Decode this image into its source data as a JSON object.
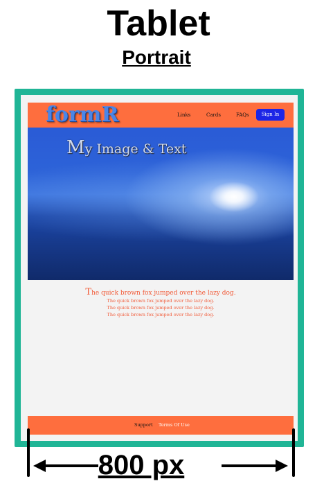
{
  "device": {
    "label": "Tablet",
    "orientation": "Portrait"
  },
  "site": {
    "logo": "formR",
    "nav": {
      "links": "Links",
      "cards": "Cards",
      "faqs": "FAQs",
      "signin": "Sign In"
    },
    "hero": {
      "title_cap": "M",
      "title_rest": "y Image & Text"
    },
    "content": {
      "lead_cap": "T",
      "lead_rest": "he quick brown fox jumped over the lazy dog.",
      "lines": [
        "The quick brown fox jumped over the lazy dog.",
        "The quick brown fox jumped over the lazy dog.",
        "The quick brown fox jumped over the lazy dog."
      ]
    },
    "footer": {
      "support": "Support",
      "terms": "Terms Of Use"
    }
  },
  "width_label": "800 px",
  "colors": {
    "frame": "#20b596",
    "navbar": "#fe6e3e",
    "signin_button": "#1c25e6",
    "logo": "#4a86e8",
    "body_text": "#f25c3a",
    "page_background": "#f3f3f3"
  },
  "icons": [
    "left-arrow-icon",
    "right-arrow-icon"
  ]
}
